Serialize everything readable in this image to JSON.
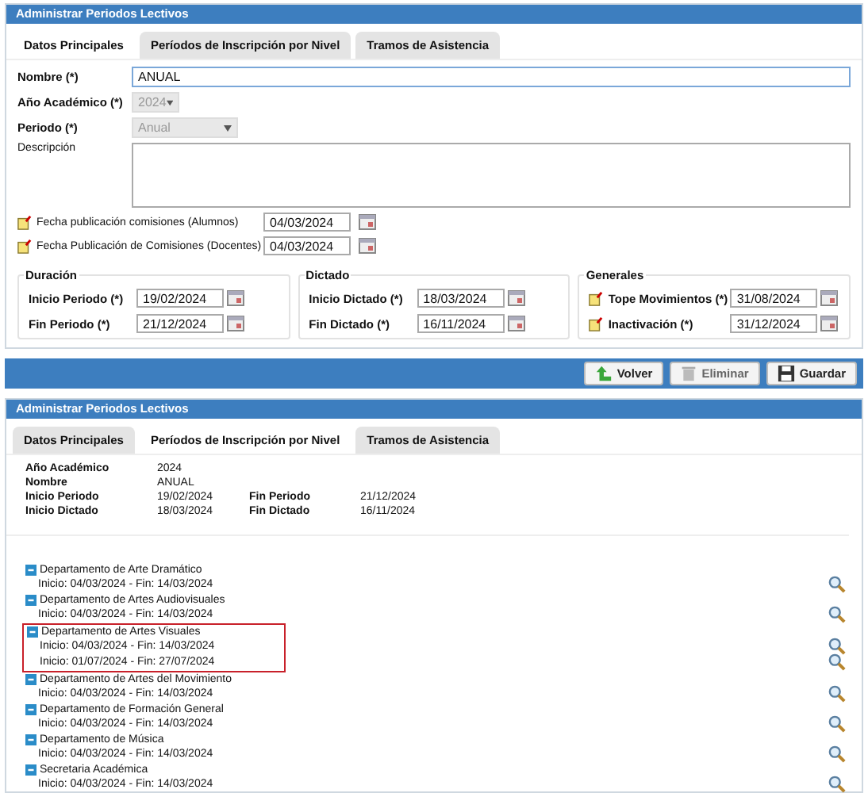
{
  "form_panel": {
    "title": "Administrar Periodos Lectivos",
    "tabs": [
      {
        "label": "Datos Principales",
        "selected": true
      },
      {
        "label": "Períodos de Inscripción por Nivel",
        "selected": false
      },
      {
        "label": "Tramos de Asistencia",
        "selected": false
      }
    ],
    "nombre": {
      "label": "Nombre (*)",
      "value": "ANUAL"
    },
    "anio": {
      "label": "Año Académico (*)",
      "value": "2024",
      "disabled": true
    },
    "periodo": {
      "label": "Periodo (*)",
      "value": "Anual",
      "disabled": true
    },
    "descripcion": {
      "label": "Descripción"
    },
    "publication_dates": [
      {
        "label": "Fecha publicación comisiones (Alumnos)",
        "value": "04/03/2024",
        "marker": true
      },
      {
        "label": "Fecha Publicación de Comisiones (Docentes)",
        "value": "04/03/2024",
        "marker": true
      }
    ],
    "groups": [
      {
        "title": "Duración",
        "fields": [
          {
            "label": "Inicio Periodo (*)",
            "value": "19/02/2024",
            "marker": false
          },
          {
            "label": "Fin Periodo (*)",
            "value": "21/12/2024",
            "marker": false
          }
        ]
      },
      {
        "title": "Dictado",
        "fields": [
          {
            "label": "Inicio Dictado (*)",
            "value": "18/03/2024",
            "marker": false
          },
          {
            "label": "Fin Dictado (*)",
            "value": "16/11/2024",
            "marker": false
          }
        ]
      },
      {
        "title": "Generales",
        "fields": [
          {
            "label": "Tope Movimientos (*)",
            "value": "31/08/2024",
            "marker": true
          },
          {
            "label": "Inactivación (*)",
            "value": "31/12/2024",
            "marker": true
          }
        ]
      }
    ],
    "buttons": [
      {
        "label": "Volver",
        "kind": "back"
      },
      {
        "label": "Eliminar",
        "kind": "delete"
      },
      {
        "label": "Guardar",
        "kind": "save"
      }
    ]
  },
  "levels_panel": {
    "title": "Administrar Periodos Lectivos",
    "tabs": [
      {
        "label": "Datos Principales",
        "selected": false
      },
      {
        "label": "Períodos de Inscripción por Nivel",
        "selected": true
      },
      {
        "label": "Tramos de Asistencia",
        "selected": false
      }
    ],
    "summary": [
      [
        "Año Académico",
        "2024"
      ],
      [
        "Nombre",
        "ANUAL"
      ],
      [
        "Inicio Periodo",
        "19/02/2024",
        "Fin Periodo",
        "21/12/2024"
      ],
      [
        "Inicio Dictado",
        "18/03/2024",
        "Fin Dictado",
        "16/11/2024"
      ]
    ],
    "departments": [
      {
        "name": "Departamento de Arte Dramático",
        "expanded": true,
        "highlighted": false,
        "periods": [
          "Inicio: 04/03/2024 - Fin: 14/03/2024"
        ]
      },
      {
        "name": "Departamento de Artes Audiovisuales",
        "expanded": true,
        "highlighted": false,
        "periods": [
          "Inicio: 04/03/2024 - Fin: 14/03/2024"
        ]
      },
      {
        "name": "Departamento de Artes Visuales",
        "expanded": true,
        "highlighted": true,
        "periods": [
          "Inicio: 04/03/2024 - Fin: 14/03/2024",
          "Inicio: 01/07/2024 - Fin: 27/07/2024"
        ]
      },
      {
        "name": "Departamento de Artes del Movimiento",
        "expanded": true,
        "highlighted": false,
        "periods": [
          "Inicio: 04/03/2024 - Fin: 14/03/2024"
        ]
      },
      {
        "name": "Departamento de Formación General",
        "expanded": true,
        "highlighted": false,
        "periods": [
          "Inicio: 04/03/2024 - Fin: 14/03/2024"
        ]
      },
      {
        "name": "Departamento de Música",
        "expanded": true,
        "highlighted": false,
        "periods": [
          "Inicio: 04/03/2024 - Fin: 14/03/2024"
        ]
      },
      {
        "name": "Secretaria Académica",
        "expanded": true,
        "highlighted": false,
        "periods": [
          "Inicio: 04/03/2024 - Fin: 14/03/2024"
        ]
      }
    ]
  }
}
